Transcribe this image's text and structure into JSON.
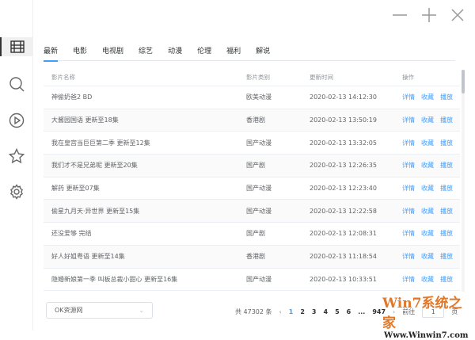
{
  "sidebar": {
    "items": [
      {
        "icon": "film-grid-icon",
        "active": true
      },
      {
        "icon": "search-icon"
      },
      {
        "icon": "play-icon"
      },
      {
        "icon": "star-icon"
      },
      {
        "icon": "gear-icon"
      }
    ]
  },
  "window": {
    "minimize": "—",
    "maximize": "+",
    "close": "×"
  },
  "tabs": [
    "最新",
    "电影",
    "电视剧",
    "综艺",
    "动漫",
    "伦理",
    "福利",
    "解说"
  ],
  "table": {
    "headers": [
      "影片名称",
      "影片类别",
      "更新时间",
      "操作"
    ],
    "actions": [
      "详情",
      "收藏",
      "播放"
    ],
    "rows": [
      [
        "神偷奶爸2 BD",
        "欧美动漫",
        "2020-02-13 14:12:30"
      ],
      [
        "大酱园国语 更新至18集",
        "香港剧",
        "2020-02-13 13:50:19"
      ],
      [
        "我在皇宫当巨巨第二季 更新至12集",
        "国产动漫",
        "2020-02-13 13:32:05"
      ],
      [
        "我们才不是兄弟呢 更新至20集",
        "国产剧",
        "2020-02-13 12:26:35"
      ],
      [
        "解药 更新至07集",
        "国产动漫",
        "2020-02-13 12:23:40"
      ],
      [
        "偷星九月天·异世界 更新至15集",
        "国产动漫",
        "2020-02-13 12:22:58"
      ],
      [
        "还没爱够 完结",
        "国产剧",
        "2020-02-13 12:08:31"
      ],
      [
        "好人好姐粤语 更新至14集",
        "香港剧",
        "2020-02-13 11:18:54"
      ],
      [
        "隐婚新娘第一季 叫板总裁小甜心 更新至16集",
        "国产动漫",
        "2020-02-13 10:33:51"
      ]
    ]
  },
  "footer": {
    "source": "OK资源网",
    "total": "共 47302 条",
    "prev": "‹",
    "pages": [
      "1",
      "2",
      "3",
      "4",
      "5",
      "6",
      "...",
      "947"
    ],
    "next": "›",
    "goto_label": "前往",
    "goto_value": "1",
    "goto_unit": "页"
  },
  "watermark": {
    "text": "Win7系统之家",
    "url": "Www.Winwin7.com"
  },
  "colors": {
    "accent": "#409eff"
  }
}
